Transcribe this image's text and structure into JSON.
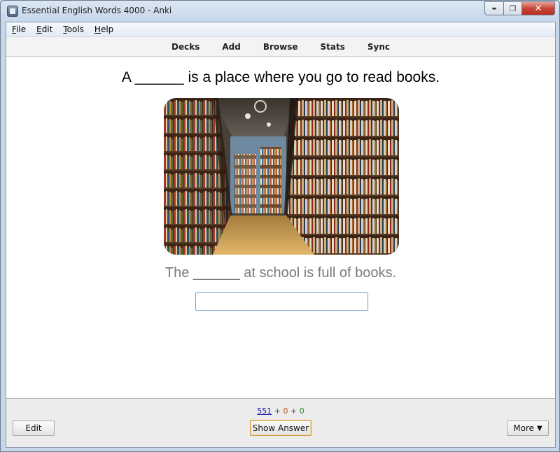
{
  "window": {
    "title": "Essential English Words 4000 - Anki",
    "icon": "anki-icon"
  },
  "window_controls": {
    "minimize": "▬",
    "maximize": "❐",
    "close": "✕"
  },
  "menu": [
    {
      "label": "File",
      "accel": "F",
      "rest": "ile"
    },
    {
      "label": "Edit",
      "accel": "E",
      "rest": "dit"
    },
    {
      "label": "Tools",
      "accel": "T",
      "rest": "ools"
    },
    {
      "label": "Help",
      "accel": "H",
      "rest": "elp"
    }
  ],
  "toolbar": {
    "decks": "Decks",
    "add": "Add",
    "browse": "Browse",
    "stats": "Stats",
    "sync": "Sync"
  },
  "card": {
    "question": "A ______ is a place where you go to read books.",
    "example": "The ______ at school is full of books.",
    "answer_value": "",
    "image": "library-bookshelves-photo"
  },
  "counts": {
    "new": "551",
    "plus1": "+",
    "learning": "0",
    "plus2": "+",
    "review": "0"
  },
  "buttons": {
    "edit": "Edit",
    "show_answer": "Show Answer",
    "more": "More",
    "more_caret": "▼"
  },
  "colors": {
    "new_count": "#1a17a8",
    "learning_count": "#b5562a",
    "review_count": "#2a8a2a",
    "show_answer_border": "#d19a3a"
  }
}
